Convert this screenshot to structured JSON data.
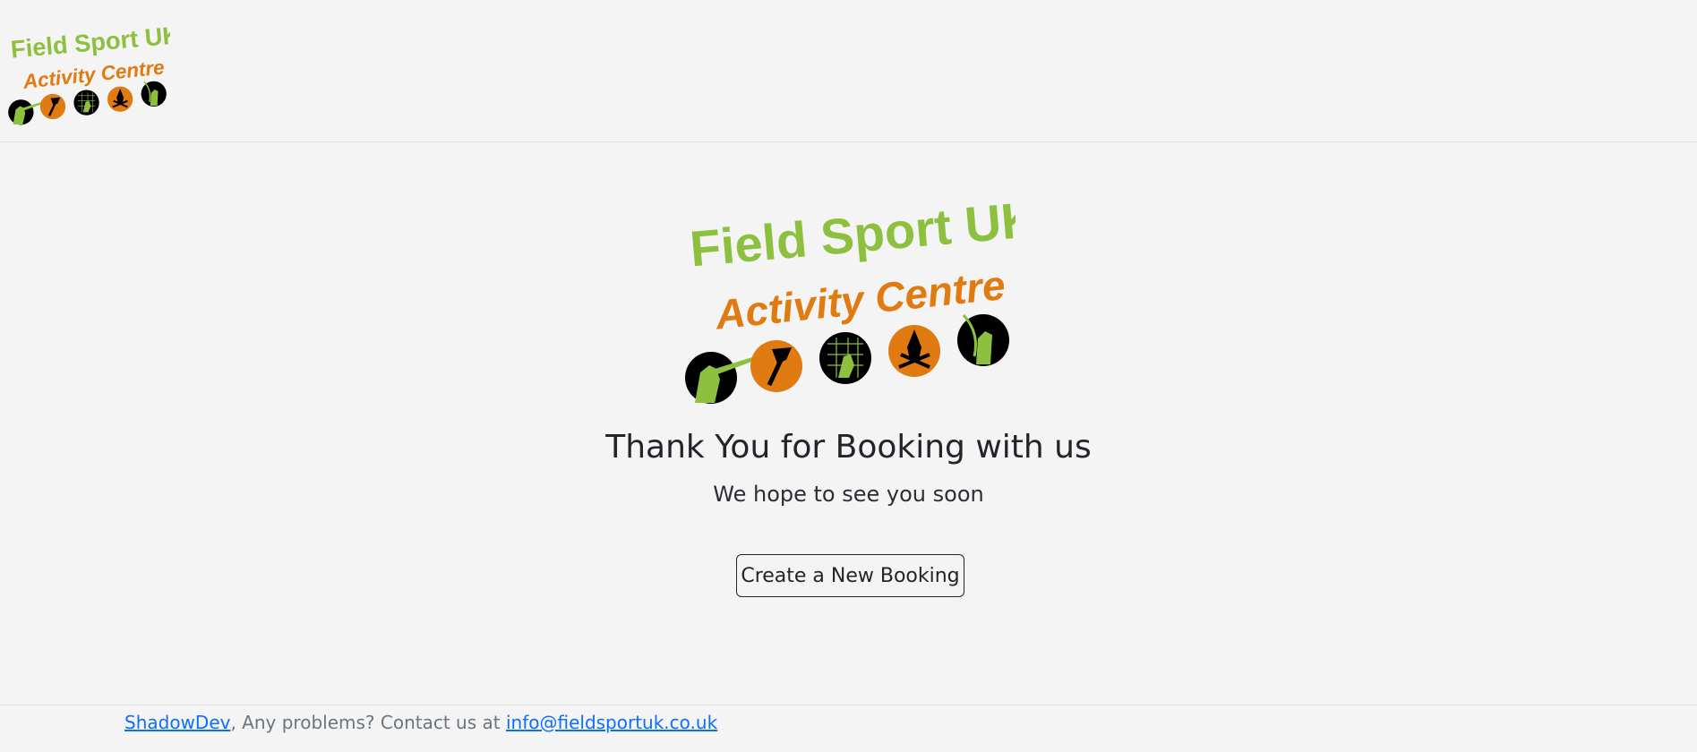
{
  "logo": {
    "line1": "Field Sport UK",
    "line2": "Activity Centre",
    "colors": {
      "green": "#8cc03e",
      "orange": "#e07b12",
      "black": "#000000"
    },
    "icons": [
      "shooting-icon",
      "axe-throwing-icon",
      "netball-icon",
      "campfire-icon",
      "archery-icon"
    ]
  },
  "main": {
    "title": "Thank You for Booking with us",
    "subtitle": "We hope to see you soon",
    "button_label": "Create a New Booking"
  },
  "footer": {
    "dev_link": "ShadowDev",
    "text": ", Any problems? Contact us at ",
    "email": "info@fieldsportuk.co.uk",
    "link_color": "#0d6efd"
  }
}
